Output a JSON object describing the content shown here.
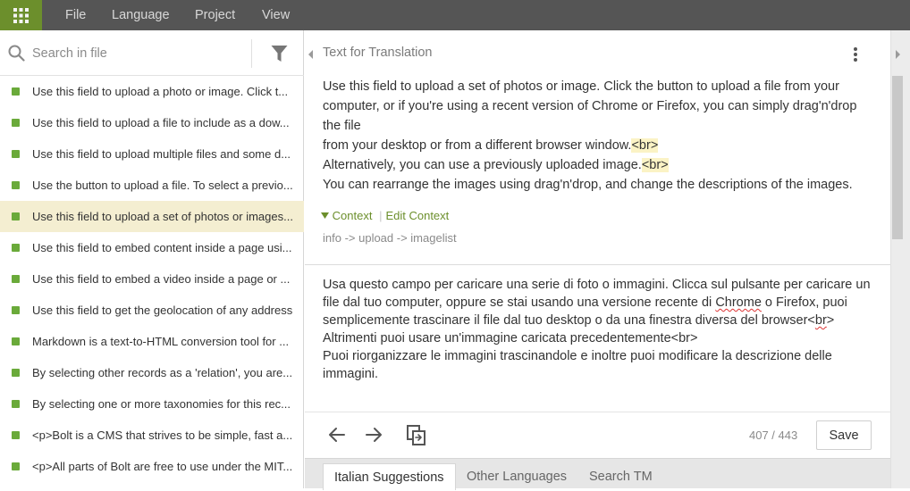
{
  "menu": {
    "apps_icon": "grid-apps-icon",
    "items": [
      "File",
      "Language",
      "Project",
      "View"
    ]
  },
  "search": {
    "placeholder": "Search in file"
  },
  "strings": [
    "Use this field to upload a photo or image. Click the button",
    "Use this field to upload a file to include as a download",
    "Use this field to upload multiple files and some descriptions",
    "Use the button to upload a file. To select a previously uploaded",
    "Use this field to upload a set of photos or images. Click",
    "Use this field to embed content inside a page using a URL",
    "Use this field to embed a video inside a page or article",
    "Use this field to get the geolocation of any address",
    "Markdown is a text-to-HTML conversion tool for web writers",
    "By selecting other records as a 'relation', you are able to",
    "By selecting one or more taxonomies for this record",
    "<p>Bolt is a CMS that strives to be simple, fast and",
    "<p>All parts of Bolt are free to use under the MIT license"
  ],
  "active_index": 4,
  "main": {
    "title": "Text for Translation",
    "source": {
      "l1": "Use this field to upload a set of photos or image. Click the button to upload a file from your computer, or if you're using a recent version of Chrome or Firefox, you can simply drag'n'drop the file",
      "l2": "from your desktop or from a different browser window.",
      "l3": "Alternatively, you can use a previously uploaded image.",
      "l4": "You can rearrange the images using drag'n'drop, and change the descriptions of the images.",
      "tag": "<br>"
    },
    "context_label": "Context",
    "edit_context_label": "Edit Context",
    "context_path": "info -> upload -> imagelist",
    "translation": {
      "p1": "Usa questo campo per caricare una serie di foto o immagini. Clicca sul pulsante per caricare un file dal tuo computer, oppure se stai usando una versione recente di ",
      "p1_chrome": "Chrome",
      "p1_end": " o Firefox, puoi semplicemente trascinare il file dal tuo desktop o da una finestra diversa del browser<",
      "br_word": "br",
      "p2_start": ">",
      "p2": "Altrimenti puoi usare un'immagine caricata precedentemente<br>",
      "p3": "Puoi riorganizzare le immagini trascinandole e inoltre puoi modificare la descrizione delle immagini."
    },
    "counter": "407 / 443",
    "save_label": "Save",
    "tabs": [
      "Italian Suggestions",
      "Other Languages",
      "Search TM"
    ]
  },
  "colors": {
    "accent": "#6c8f2c",
    "dot": "#6aaa3a",
    "active_row": "#f4eed1",
    "topbar": "#555555",
    "tag_highlight": "#fbf3c5"
  }
}
